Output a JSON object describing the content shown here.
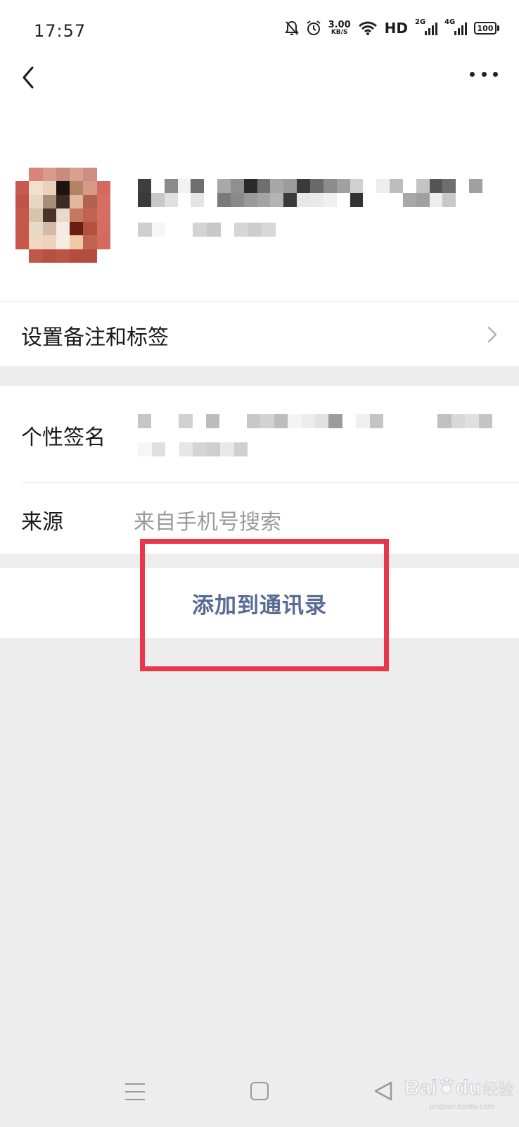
{
  "status_bar": {
    "time": "17:57",
    "net_speed_value": "3.00",
    "net_speed_unit": "KB/S",
    "hd_label": "HD",
    "sim1_label": "2G",
    "sim2_label": "4G",
    "battery": "100"
  },
  "profile": {
    "name_redacted": true,
    "avatar_redacted": true
  },
  "rows": {
    "remark_tags": "设置备注和标签",
    "signature_label": "个性签名",
    "source_label": "来源",
    "source_value": "来自手机号搜索"
  },
  "action": {
    "add_contact_label": "添加到通讯录"
  },
  "watermark": {
    "brand": "Bai",
    "brand2": "du",
    "product": "经验",
    "url": "jingyan.baidu.com"
  },
  "colors": {
    "link_blue": "#576b95",
    "highlight_red": "#e8364c",
    "background": "#ededed"
  }
}
